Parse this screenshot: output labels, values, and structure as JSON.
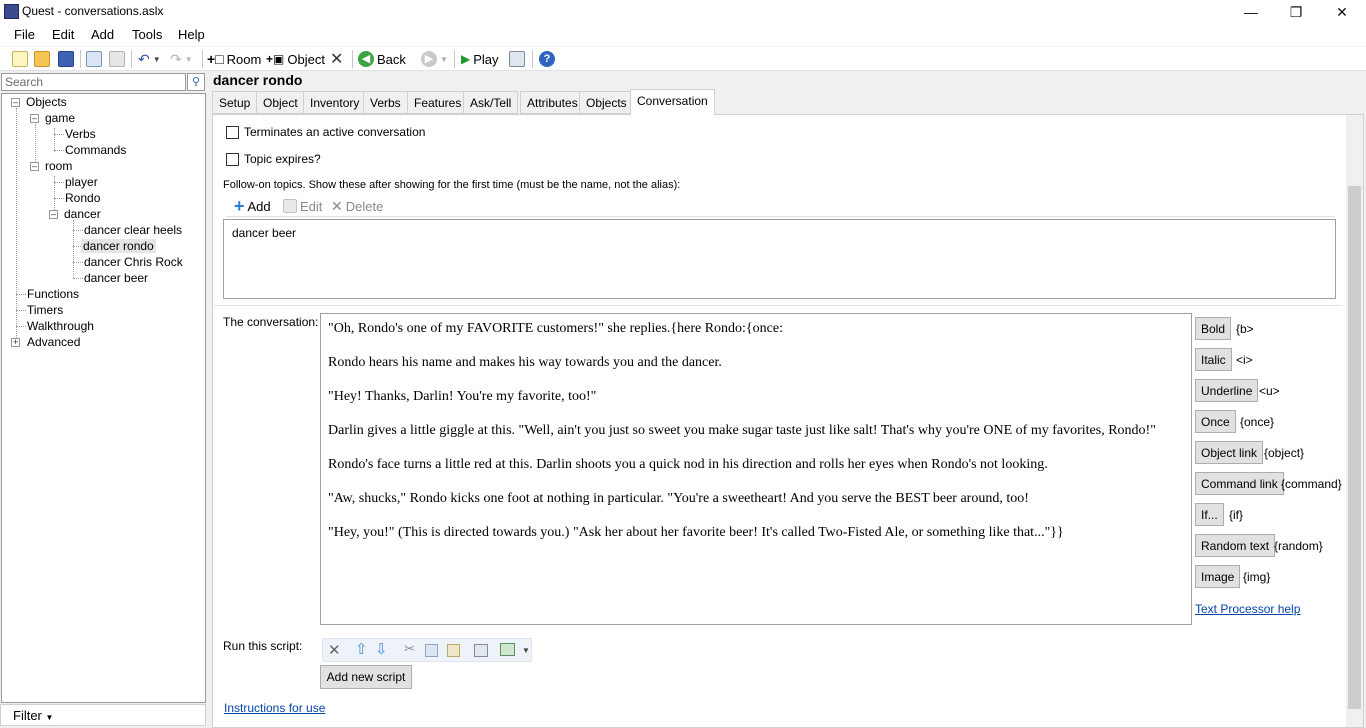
{
  "window": {
    "title": "Quest - conversations.aslx",
    "minimize_glyph": "—",
    "maximize_glyph": "❐",
    "close_glyph": "✕"
  },
  "menu": [
    "File",
    "Edit",
    "Add",
    "Tools",
    "Help"
  ],
  "toolbar": {
    "room": "Room",
    "object": "Object",
    "back": "Back",
    "play": "Play"
  },
  "search": {
    "placeholder": "Search",
    "icon": "magnifier-icon"
  },
  "tree": {
    "objects": "Objects",
    "game": "game",
    "verbs": "Verbs",
    "commands": "Commands",
    "room": "room",
    "player": "player",
    "rondo": "Rondo",
    "dancer": "dancer",
    "dancer_clear_heels": "dancer clear heels",
    "dancer_rondo": "dancer rondo",
    "dancer_chris_rock": "dancer Chris Rock",
    "dancer_beer": "dancer beer",
    "functions": "Functions",
    "timers": "Timers",
    "walkthrough": "Walkthrough",
    "advanced": "Advanced"
  },
  "filter": "Filter",
  "object_title": "dancer rondo",
  "tabs": [
    "Setup",
    "Object",
    "Inventory",
    "Verbs",
    "Features",
    "Ask/Tell",
    "Attributes",
    "Objects",
    "Conversation"
  ],
  "conversation_tab": {
    "terminates": "Terminates an active conversation",
    "topic_expires": "Topic expires?",
    "followon": "Follow-on topics. Show these after showing for the first time (must be the name, not the alias):",
    "list_add": "Add",
    "list_edit": "Edit",
    "list_delete": "Delete",
    "list_items": [
      "dancer beer"
    ],
    "convo_label": "The conversation:",
    "convo_text": [
      "\"Oh, Rondo's one of my FAVORITE customers!\" she replies.{here Rondo:{once:",
      "Rondo hears his name and makes his way towards you and the dancer.",
      "\"Hey!  Thanks, Darlin!  You're my favorite, too!\"",
      "Darlin gives a little giggle at this.  \"Well, ain't you just so sweet you make sugar taste just like salt!  That's why you're ONE of my favorites, Rondo!\"",
      "Rondo's face turns a little red at this.  Darlin shoots you a quick nod in his direction and rolls her eyes when Rondo's not looking.",
      "\"Aw, shucks,\" Rondo kicks one foot at nothing in particular.  \"You're a sweetheart!  And you serve the BEST beer around, too!",
      "\"Hey, you!\"  (This is directed towards you.)  \"Ask her about her favorite beer!  It's called Two-Fisted Ale, or something like that...\"}}"
    ],
    "format_buttons": [
      {
        "label": "Bold",
        "code": "{b>"
      },
      {
        "label": "Italic",
        "code": "<i>"
      },
      {
        "label": "Underline",
        "code": "<u>"
      },
      {
        "label": "Once",
        "code": "{once}"
      },
      {
        "label": "Object link",
        "code": "{object}"
      },
      {
        "label": "Command link",
        "code": "{command}"
      },
      {
        "label": "If...",
        "code": "{if}"
      },
      {
        "label": "Random text",
        "code": "{random}"
      },
      {
        "label": "Image",
        "code": "{img}"
      }
    ],
    "text_processor_help": "Text Processor help",
    "run_script": "Run this script:",
    "add_new_script": "Add new script",
    "instructions": "Instructions for use"
  }
}
